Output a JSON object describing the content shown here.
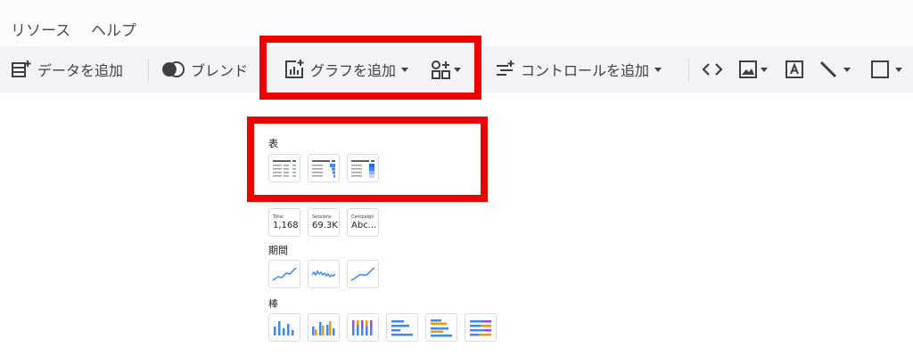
{
  "menu": {
    "items": [
      "リソース",
      "ヘルプ"
    ]
  },
  "toolbar": {
    "add_data": "データを追加",
    "blend": "ブレンド",
    "add_chart": "グラフを追加",
    "add_control": "コントロールを追加"
  },
  "chart_menu": {
    "table_label": "表",
    "timeseries_label": "期間",
    "bar_label": "棒",
    "scorecards": [
      {
        "title": "Total",
        "value": "1,168"
      },
      {
        "title": "Sessions",
        "value": "69.3K"
      },
      {
        "title": "Campaign",
        "value": "Abc..."
      }
    ]
  },
  "colors": {
    "highlight": "#ee0000",
    "accent_blue": "#4285f4",
    "accent_orange": "#f29900",
    "accent_purple": "#a142f4",
    "menubar_bg": "#fafbfd",
    "toolbar_bg": "#f1f3f6"
  },
  "icons": [
    "add-data-icon",
    "blend-icon",
    "add-chart-icon",
    "community-viz-icon",
    "add-control-icon",
    "embed-code-icon",
    "image-icon",
    "text-icon",
    "line-icon",
    "rectangle-icon"
  ]
}
